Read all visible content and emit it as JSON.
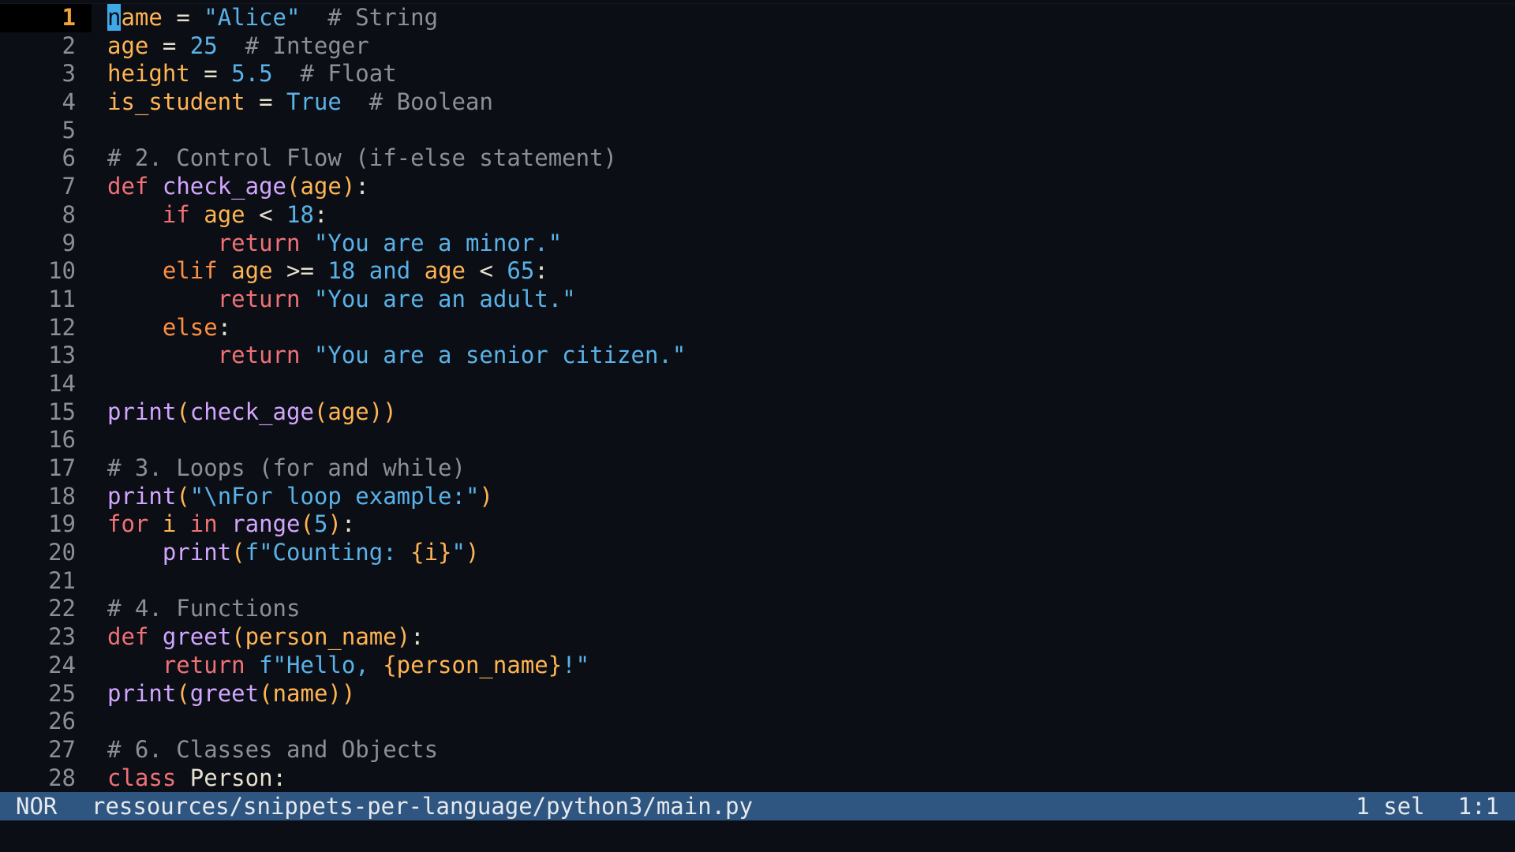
{
  "editor": {
    "lines": [
      {
        "n": "1",
        "current": true,
        "tokens": [
          {
            "t": "n",
            "c": "cursor"
          },
          {
            "t": "ame",
            "c": "t-var"
          },
          {
            "t": " = ",
            "c": "t-op"
          },
          {
            "t": "\"Alice\"",
            "c": "t-str"
          },
          {
            "t": "  # String",
            "c": "t-comment"
          }
        ]
      },
      {
        "n": "2",
        "tokens": [
          {
            "t": "age",
            "c": "t-var"
          },
          {
            "t": " = ",
            "c": "t-op"
          },
          {
            "t": "25",
            "c": "t-num"
          },
          {
            "t": "  # Integer",
            "c": "t-comment"
          }
        ]
      },
      {
        "n": "3",
        "tokens": [
          {
            "t": "height",
            "c": "t-var"
          },
          {
            "t": " = ",
            "c": "t-op"
          },
          {
            "t": "5.5",
            "c": "t-num"
          },
          {
            "t": "  # Float",
            "c": "t-comment"
          }
        ]
      },
      {
        "n": "4",
        "tokens": [
          {
            "t": "is_student",
            "c": "t-var"
          },
          {
            "t": " = ",
            "c": "t-op"
          },
          {
            "t": "True",
            "c": "t-const"
          },
          {
            "t": "  # Boolean",
            "c": "t-comment"
          }
        ]
      },
      {
        "n": "5",
        "tokens": []
      },
      {
        "n": "6",
        "tokens": [
          {
            "t": "# 2. Control Flow (if-else statement)",
            "c": "t-comment"
          }
        ]
      },
      {
        "n": "7",
        "tokens": [
          {
            "t": "def",
            "c": "t-kw2"
          },
          {
            "t": " ",
            "c": "t-plain"
          },
          {
            "t": "check_age",
            "c": "t-fn"
          },
          {
            "t": "(",
            "c": "t-paren"
          },
          {
            "t": "age",
            "c": "t-var"
          },
          {
            "t": ")",
            "c": "t-paren"
          },
          {
            "t": ":",
            "c": "t-punct"
          }
        ]
      },
      {
        "n": "8",
        "tokens": [
          {
            "t": "    ",
            "c": "t-plain"
          },
          {
            "t": "if",
            "c": "t-kw2"
          },
          {
            "t": " ",
            "c": "t-plain"
          },
          {
            "t": "age",
            "c": "t-var"
          },
          {
            "t": " < ",
            "c": "t-op"
          },
          {
            "t": "18",
            "c": "t-num"
          },
          {
            "t": ":",
            "c": "t-punct"
          }
        ]
      },
      {
        "n": "9",
        "tokens": [
          {
            "t": "        ",
            "c": "t-plain"
          },
          {
            "t": "return",
            "c": "t-kw2"
          },
          {
            "t": " ",
            "c": "t-plain"
          },
          {
            "t": "\"You are a minor.\"",
            "c": "t-str"
          }
        ]
      },
      {
        "n": "10",
        "tokens": [
          {
            "t": "    ",
            "c": "t-plain"
          },
          {
            "t": "elif",
            "c": "t-kw"
          },
          {
            "t": " ",
            "c": "t-plain"
          },
          {
            "t": "age",
            "c": "t-var"
          },
          {
            "t": " >= ",
            "c": "t-op"
          },
          {
            "t": "18",
            "c": "t-num"
          },
          {
            "t": " ",
            "c": "t-plain"
          },
          {
            "t": "and",
            "c": "t-const"
          },
          {
            "t": " ",
            "c": "t-plain"
          },
          {
            "t": "age",
            "c": "t-var"
          },
          {
            "t": " < ",
            "c": "t-op"
          },
          {
            "t": "65",
            "c": "t-num"
          },
          {
            "t": ":",
            "c": "t-punct"
          }
        ]
      },
      {
        "n": "11",
        "tokens": [
          {
            "t": "        ",
            "c": "t-plain"
          },
          {
            "t": "return",
            "c": "t-kw2"
          },
          {
            "t": " ",
            "c": "t-plain"
          },
          {
            "t": "\"You are an adult.\"",
            "c": "t-str"
          }
        ]
      },
      {
        "n": "12",
        "tokens": [
          {
            "t": "    ",
            "c": "t-plain"
          },
          {
            "t": "else",
            "c": "t-kw"
          },
          {
            "t": ":",
            "c": "t-punct"
          }
        ]
      },
      {
        "n": "13",
        "tokens": [
          {
            "t": "        ",
            "c": "t-plain"
          },
          {
            "t": "return",
            "c": "t-kw2"
          },
          {
            "t": " ",
            "c": "t-plain"
          },
          {
            "t": "\"You are a senior citizen.\"",
            "c": "t-str"
          }
        ]
      },
      {
        "n": "14",
        "tokens": []
      },
      {
        "n": "15",
        "tokens": [
          {
            "t": "print",
            "c": "t-builtin"
          },
          {
            "t": "(",
            "c": "t-paren"
          },
          {
            "t": "check_age",
            "c": "t-fn"
          },
          {
            "t": "(",
            "c": "t-paren"
          },
          {
            "t": "age",
            "c": "t-var"
          },
          {
            "t": "))",
            "c": "t-paren"
          }
        ]
      },
      {
        "n": "16",
        "tokens": []
      },
      {
        "n": "17",
        "tokens": [
          {
            "t": "# 3. Loops (for and while)",
            "c": "t-comment"
          }
        ]
      },
      {
        "n": "18",
        "tokens": [
          {
            "t": "print",
            "c": "t-builtin"
          },
          {
            "t": "(",
            "c": "t-paren"
          },
          {
            "t": "\"\\nFor loop example:\"",
            "c": "t-str"
          },
          {
            "t": ")",
            "c": "t-paren"
          }
        ]
      },
      {
        "n": "19",
        "tokens": [
          {
            "t": "for",
            "c": "t-kw2"
          },
          {
            "t": " ",
            "c": "t-plain"
          },
          {
            "t": "i",
            "c": "t-var"
          },
          {
            "t": " ",
            "c": "t-plain"
          },
          {
            "t": "in",
            "c": "t-kw2"
          },
          {
            "t": " ",
            "c": "t-plain"
          },
          {
            "t": "range",
            "c": "t-builtin"
          },
          {
            "t": "(",
            "c": "t-paren"
          },
          {
            "t": "5",
            "c": "t-num"
          },
          {
            "t": ")",
            "c": "t-paren"
          },
          {
            "t": ":",
            "c": "t-punct"
          }
        ]
      },
      {
        "n": "20",
        "tokens": [
          {
            "t": "    ",
            "c": "t-plain"
          },
          {
            "t": "print",
            "c": "t-builtin"
          },
          {
            "t": "(",
            "c": "t-paren"
          },
          {
            "t": "f\"Counting: ",
            "c": "t-str"
          },
          {
            "t": "{i}",
            "c": "t-fmt"
          },
          {
            "t": "\"",
            "c": "t-str"
          },
          {
            "t": ")",
            "c": "t-paren"
          }
        ]
      },
      {
        "n": "21",
        "tokens": []
      },
      {
        "n": "22",
        "tokens": [
          {
            "t": "# 4. Functions",
            "c": "t-comment"
          }
        ]
      },
      {
        "n": "23",
        "tokens": [
          {
            "t": "def",
            "c": "t-kw2"
          },
          {
            "t": " ",
            "c": "t-plain"
          },
          {
            "t": "greet",
            "c": "t-fn"
          },
          {
            "t": "(",
            "c": "t-paren"
          },
          {
            "t": "person_name",
            "c": "t-var"
          },
          {
            "t": ")",
            "c": "t-paren"
          },
          {
            "t": ":",
            "c": "t-punct"
          }
        ]
      },
      {
        "n": "24",
        "tokens": [
          {
            "t": "    ",
            "c": "t-plain"
          },
          {
            "t": "return",
            "c": "t-kw2"
          },
          {
            "t": " ",
            "c": "t-plain"
          },
          {
            "t": "f\"Hello, ",
            "c": "t-str"
          },
          {
            "t": "{person_name}",
            "c": "t-fmt"
          },
          {
            "t": "!\"",
            "c": "t-str"
          }
        ]
      },
      {
        "n": "25",
        "tokens": [
          {
            "t": "print",
            "c": "t-builtin"
          },
          {
            "t": "(",
            "c": "t-paren"
          },
          {
            "t": "greet",
            "c": "t-fn"
          },
          {
            "t": "(",
            "c": "t-paren"
          },
          {
            "t": "name",
            "c": "t-var"
          },
          {
            "t": "))",
            "c": "t-paren"
          }
        ]
      },
      {
        "n": "26",
        "tokens": []
      },
      {
        "n": "27",
        "tokens": [
          {
            "t": "# 6. Classes and Objects",
            "c": "t-comment"
          }
        ]
      },
      {
        "n": "28",
        "tokens": [
          {
            "t": "class",
            "c": "t-kw2"
          },
          {
            "t": " ",
            "c": "t-plain"
          },
          {
            "t": "Person",
            "c": "t-plain"
          },
          {
            "t": ":",
            "c": "t-punct"
          }
        ]
      }
    ]
  },
  "statusbar": {
    "mode": "NOR",
    "filepath": "ressources/snippets-per-language/python3/main.py",
    "selection": "1 sel",
    "position": "1:1"
  },
  "colors": {
    "background": "#0b0e14",
    "statusbar": "#2f5681",
    "cursor": "#3fa9e8",
    "current_line_number": "#f2a33a"
  }
}
